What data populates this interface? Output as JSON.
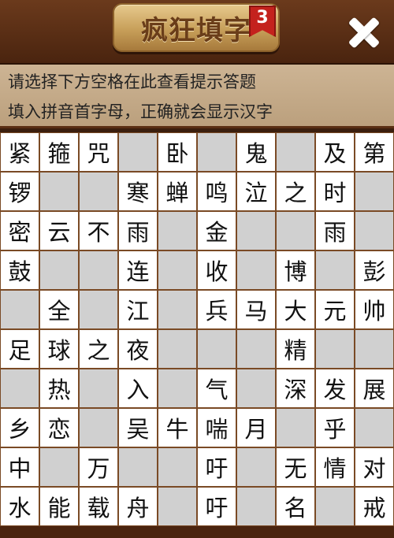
{
  "header": {
    "title": "疯狂填字",
    "level_badge": "3",
    "close_icon": "close-icon"
  },
  "hints": {
    "line1": "请选择下方空格在此查看提示答题",
    "line2": "填入拼音首字母，正确就会显示汉字"
  },
  "colors": {
    "header_bg": "#5a2f14",
    "hint_bg": "#c8ae8c",
    "cell_white": "#ffffff",
    "cell_blocked": "#d0d0d0",
    "badge": "#c4221d"
  },
  "grid": {
    "rows": [
      [
        "紧",
        "箍",
        "咒",
        "#",
        "卧",
        "#",
        "鬼",
        "#",
        "及",
        "第"
      ],
      [
        "锣",
        "#",
        "#",
        "寒",
        "蝉",
        "鸣",
        "泣",
        "之",
        "时",
        "#"
      ],
      [
        "密",
        "云",
        "不",
        "雨",
        "#",
        "金",
        "#",
        "#",
        "雨",
        "#"
      ],
      [
        "鼓",
        "#",
        "#",
        "连",
        "#",
        "收",
        "#",
        "博",
        "#",
        "彭"
      ],
      [
        "#",
        "全",
        "#",
        "江",
        "#",
        "兵",
        "马",
        "大",
        "元",
        "帅"
      ],
      [
        "足",
        "球",
        "之",
        "夜",
        "#",
        "#",
        "#",
        "精",
        "#",
        "#"
      ],
      [
        "#",
        "热",
        "#",
        "入",
        "#",
        "气",
        "#",
        "深",
        "发",
        "展"
      ],
      [
        "乡",
        "恋",
        "#",
        "吴",
        "牛",
        "喘",
        "月",
        "#",
        "乎",
        "#"
      ],
      [
        "中",
        "#",
        "万",
        "#",
        "#",
        "吁",
        "#",
        "无",
        "情",
        "对"
      ],
      [
        "水",
        "能",
        "载",
        "舟",
        "#",
        "吁",
        "#",
        "名",
        "#",
        "戒"
      ]
    ]
  }
}
